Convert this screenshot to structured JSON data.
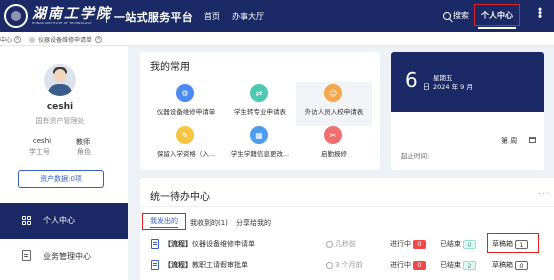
{
  "header": {
    "logo_text": "湖南工学院",
    "logo_subtitle": "HUNAN INSTITUTE OF TECHNOLOGY",
    "platform": "一站式服务平台",
    "nav": [
      "首页",
      "办事大厅"
    ],
    "search": "搜索",
    "personal_center": "个人中心"
  },
  "tabs": [
    {
      "label": "中心"
    },
    {
      "label": "仪器设备维修申请单"
    }
  ],
  "profile": {
    "name": "ceshi",
    "dept": "国有资产管理处",
    "id_value": "ceshi",
    "id_label": "学工号",
    "role_value": "教师",
    "role_label": "角色",
    "asset_button": "资产数据:0项"
  },
  "sidebar": {
    "items": [
      {
        "label": "个人中心",
        "icon": "grid-icon",
        "active": true
      },
      {
        "label": "业务管理中心",
        "icon": "briefcase-icon",
        "active": false
      }
    ]
  },
  "common": {
    "title": "我的常用",
    "apps": [
      {
        "label": "仪器设备维修申请单",
        "icon": "wrench-icon",
        "color": "#4a8af4"
      },
      {
        "label": "学生转专业申请表",
        "icon": "swap-icon",
        "color": "#4cc9b0"
      },
      {
        "label": "外访人员入校申请表",
        "icon": "people-icon",
        "color": "#f5a54a"
      },
      {
        "label": "保留入学资格（入...",
        "icon": "document-icon",
        "color": "#f4c542"
      },
      {
        "label": "学生学籍信息更改...",
        "icon": "calendar-icon",
        "color": "#4d9cf0"
      },
      {
        "label": "启勤报修",
        "icon": "repair-icon",
        "color": "#f07070"
      }
    ]
  },
  "calendar": {
    "day": "6",
    "day_unit": "日",
    "weekday": "星期五",
    "month": "2024 年 9 月",
    "week_label": "第 周",
    "time_label": "起止时间:"
  },
  "todo": {
    "title": "统一待办中心",
    "more": "...",
    "tabs": [
      "我发出的",
      "我收到的(1)",
      "分享给我的"
    ],
    "rows": [
      {
        "tag": "【流程】",
        "title": "仪器设备维修申请单",
        "time": "几秒前",
        "in_progress_label": "进行中",
        "in_progress": "0",
        "done_label": "已结束",
        "done": "0",
        "draft_label": "草稿箱",
        "draft": "1"
      },
      {
        "tag": "【流程】",
        "title": "教职工请假审批单",
        "time": "3 个月前",
        "in_progress_label": "进行中",
        "in_progress": "0",
        "done_label": "已结束",
        "done": "2",
        "draft_label": "草稿箱",
        "draft": "0"
      }
    ]
  },
  "colors": {
    "primary": "#1b2a66",
    "accent": "#3a5fcd",
    "highlight_box": "#e02020",
    "badge_red": "#f04848",
    "badge_teal": "#2ba98c"
  }
}
